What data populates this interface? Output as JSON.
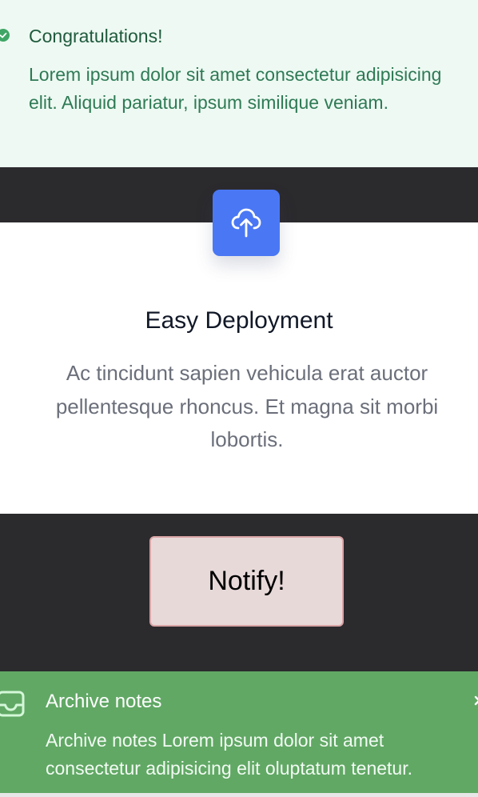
{
  "success_alert": {
    "title": "Congratulations!",
    "text": "Lorem ipsum dolor sit amet consectetur adipisicing elit. Aliquid pariatur, ipsum similique veniam.",
    "icon": "check-circle-icon"
  },
  "feature": {
    "icon": "cloud-upload-icon",
    "title": "Easy Deployment",
    "text": "Ac tincidunt sapien vehicula erat auctor pellentesque rhoncus. Et magna sit morbi lobortis."
  },
  "notify_button": {
    "label": "Notify!"
  },
  "archive_alert": {
    "icon": "inbox-icon",
    "title": "Archive notes",
    "text": "Archive notes Lorem ipsum dolor sit amet consectetur adipisicing elit oluptatum tenetur.",
    "close_icon": "close-icon"
  },
  "colors": {
    "page_background": "#2b2a2d",
    "success_background": "#edf9f2",
    "success_title": "#1f5a3c",
    "success_text": "#2f7a55",
    "feature_icon_background": "#4a78f4",
    "notify_background": "#e8d9d9",
    "notify_border": "#d9a5a5",
    "archive_background": "#61a865"
  }
}
